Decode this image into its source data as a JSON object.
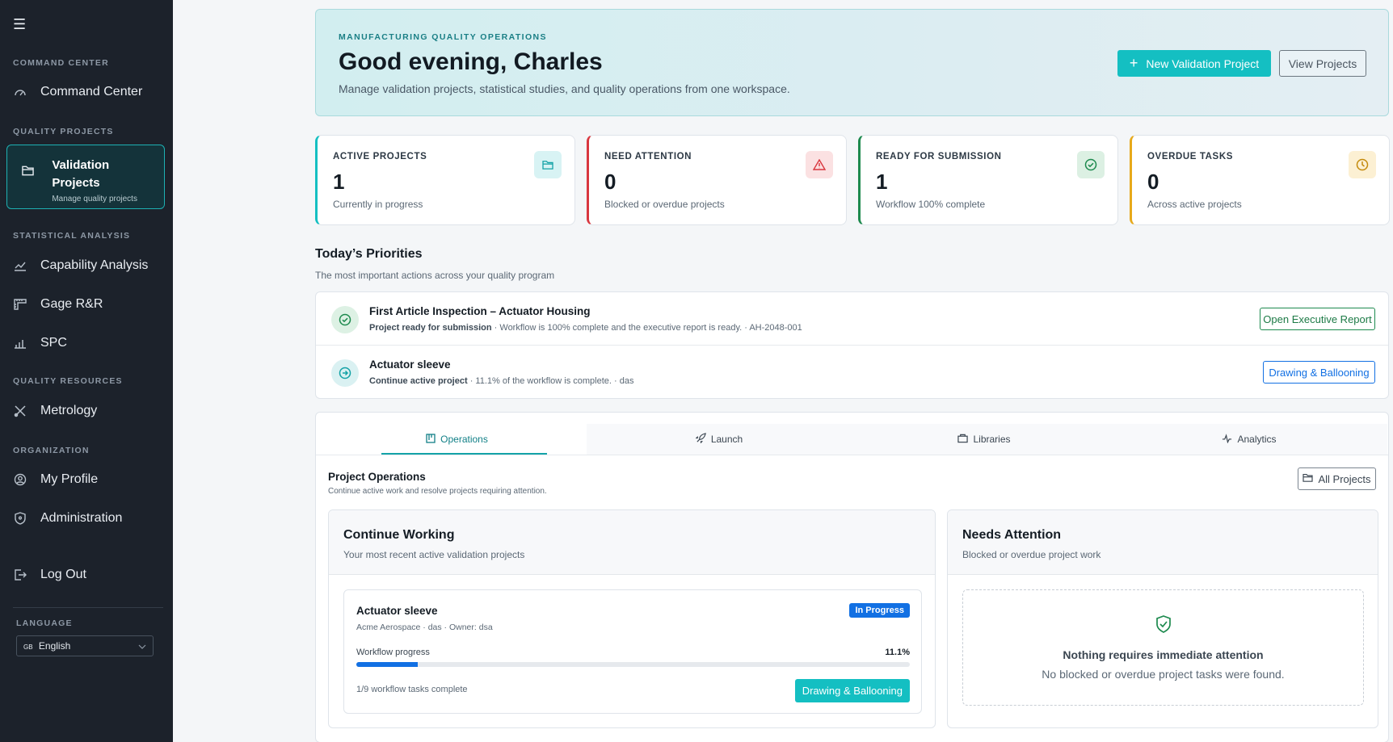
{
  "sidebar": {
    "sections": {
      "command_center": "COMMAND CENTER",
      "quality_projects": "QUALITY PROJECTS",
      "statistical_analysis": "STATISTICAL ANALYSIS",
      "quality_resources": "QUALITY RESOURCES",
      "organization": "ORGANIZATION",
      "language": "LANGUAGE"
    },
    "items": {
      "command_center": "Command Center",
      "validation_projects": "Validation Projects",
      "validation_projects_sub": "Manage quality projects",
      "capability_analysis": "Capability Analysis",
      "gage_rr": "Gage R&R",
      "spc": "SPC",
      "metrology": "Metrology",
      "my_profile": "My Profile",
      "administration": "Administration",
      "log_out": "Log Out"
    },
    "language": {
      "flag": "GB",
      "selected": "English"
    }
  },
  "hero": {
    "eyebrow": "MANUFACTURING QUALITY OPERATIONS",
    "greeting": "Good evening, Charles",
    "subtitle": "Manage validation projects, statistical studies, and quality operations from one workspace.",
    "primary_button": "New Validation Project",
    "secondary_button": "View Projects"
  },
  "stats": [
    {
      "label": "ACTIVE PROJECTS",
      "value": "1",
      "desc": "Currently in progress",
      "color": "#14bfc2"
    },
    {
      "label": "NEED ATTENTION",
      "value": "0",
      "desc": "Blocked or overdue projects",
      "color": "#d9373f"
    },
    {
      "label": "READY FOR SUBMISSION",
      "value": "1",
      "desc": "Workflow 100% complete",
      "color": "#1d8a4e"
    },
    {
      "label": "OVERDUE TASKS",
      "value": "0",
      "desc": "Across active projects",
      "color": "#e7a91a"
    }
  ],
  "priorities": {
    "title": "Today’s Priorities",
    "subtitle": "The most important actions across your quality program",
    "rows": [
      {
        "title": "First Article Inspection – Actuator Housing",
        "lead": "Project ready for submission",
        "detail": " · Workflow is 100% complete and the executive report is ready. · AH-2048-001",
        "button": "Open Executive Report"
      },
      {
        "title": "Actuator sleeve",
        "lead": "Continue active project",
        "detail": " · 11.1% of the workflow is complete. · das",
        "button": "Drawing & Ballooning"
      }
    ]
  },
  "tabs": [
    "Operations",
    "Launch",
    "Libraries",
    "Analytics"
  ],
  "operations": {
    "title": "Project Operations",
    "subtitle": "Continue active work and resolve projects requiring attention.",
    "all_projects": "All Projects",
    "continue_working": {
      "title": "Continue Working",
      "subtitle": "Your most recent active validation projects",
      "project": {
        "name": "Actuator sleeve",
        "meta": "Acme Aerospace · das · Owner: dsa",
        "status": "In Progress",
        "progress_label": "Workflow progress",
        "progress_value": "11.1%",
        "progress": 0.111,
        "tasks": "1/9 workflow tasks complete",
        "action": "Drawing & Ballooning"
      }
    },
    "needs_attention": {
      "title": "Needs Attention",
      "subtitle": "Blocked or overdue project work",
      "empty_title": "Nothing requires immediate attention",
      "empty_desc": "No blocked or overdue project tasks were found."
    }
  }
}
